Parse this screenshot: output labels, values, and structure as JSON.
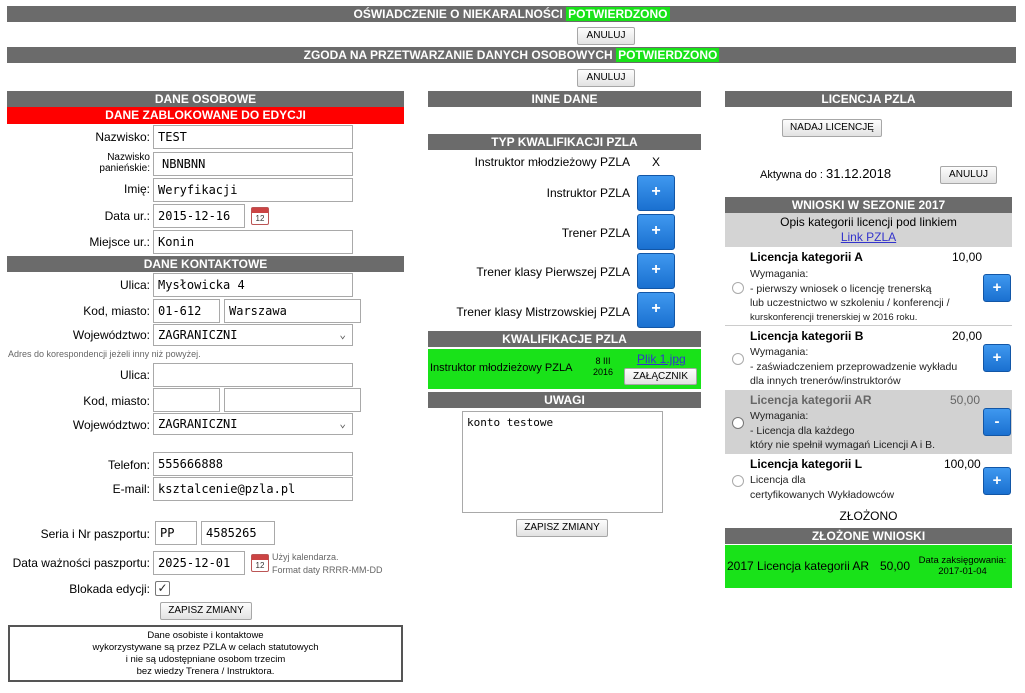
{
  "banners": {
    "statement": {
      "text": "OŚWIADCZENIE O NIEKARALNOŚCI",
      "status": "POTWIERDZONO",
      "cancel": "ANULUJ"
    },
    "consent": {
      "text": "ZGODA NA PRZETWARZANIE DANYCH OSOBOWYCH",
      "status": "POTWIERDZONO",
      "cancel": "ANULUJ"
    }
  },
  "personal": {
    "header": "DANE OSOBOWE",
    "locked": "DANE ZABLOKOWANE DO EDYCJI",
    "surname_label": "Nazwisko:",
    "surname": "TEST",
    "maiden_label_1": "Nazwisko",
    "maiden_label_2": "panieńskie:",
    "maiden": "NBNBNN",
    "name_label": "Imię:",
    "name": "Weryfikacji",
    "birth_label": "Data ur.:",
    "birth": "2015-12-16",
    "birthplace_label": "Miejsce ur.:",
    "birthplace": "Konin"
  },
  "contact": {
    "header": "DANE KONTAKTOWE",
    "street_label": "Ulica:",
    "street": "Mysłowicka 4",
    "postal_label": "Kod, miasto:",
    "postal": "01-612",
    "city": "Warszawa",
    "province_label": "Województwo:",
    "province": "ZAGRANICZNI",
    "corr_note": "Adres do korespondencji jeżeli inny niż powyżej.",
    "street2_label": "Ulica:",
    "street2": "",
    "postal2_label": "Kod, miasto:",
    "postal2": "",
    "city2": "",
    "province2_label": "Województwo:",
    "province2": "ZAGRANICZNI",
    "phone_label": "Telefon:",
    "phone": "555666888",
    "email_label": "E-mail:",
    "email": "ksztalcenie@pzla.pl",
    "passport_label": "Seria i Nr paszportu:",
    "passport_series": "PP",
    "passport_no": "4585265",
    "passport_valid_label": "Data ważności paszportu:",
    "passport_valid": "2025-12-01",
    "calendar_hint_1": "Użyj kalendarza.",
    "calendar_hint_2": "Format daty RRRR-MM-DD",
    "lock_label": "Blokada edycji:",
    "save": "ZAPISZ ZMIANY",
    "privacy_1": "Dane osobiste i kontaktowe",
    "privacy_2": "wykorzystywane są przez PZLA w celach statutowych",
    "privacy_3": "i nie są udostępniane osobom trzecim",
    "privacy_4": "bez wiedzy Trenera / Instruktora."
  },
  "other": {
    "header": "INNE DANE",
    "qual_type_header": "TYP KWALIFIKACJI PZLA",
    "qual_types": [
      {
        "label": "Instruktor młodzieżowy PZLA",
        "mark": "X"
      },
      {
        "label": "Instruktor PZLA",
        "mark": "+"
      },
      {
        "label": "Trener PZLA",
        "mark": "+"
      },
      {
        "label": "Trener klasy Pierwszej PZLA",
        "mark": "+"
      },
      {
        "label": "Trener klasy Mistrzowskiej PZLA",
        "mark": "+"
      }
    ],
    "quals_header": "KWALIFIKACJE PZLA",
    "qual": {
      "name": "Instruktor młodzieżowy PZLA",
      "date_1": "8 III",
      "date_2": "2016",
      "file": "Plik 1.jpg",
      "attach": "ZAŁĄCZNIK"
    },
    "notes_header": "UWAGI",
    "notes": "konto testowe",
    "save": "ZAPISZ ZMIANY"
  },
  "license": {
    "header": "LICENCJA PZLA",
    "grant": "NADAJ LICENCJĘ",
    "active_label": "Aktywna do :",
    "active_date": "31.12.2018",
    "cancel": "ANULUJ",
    "season_header": "WNIOSKI W SEZONIE 2017",
    "desc": "Opis kategorii licencji pod linkiem",
    "link": "Link PZLA",
    "categories": [
      {
        "name": "Licencja kategorii A",
        "price": "10,00",
        "req": "Wymagania:",
        "l1": "- pierwszy wniosek o licencję trenerską",
        "l2": "lub uczestnictwo w szkoleniu / konferencji /",
        "l3": "kurskonferencji trenerskiej w 2016 roku.",
        "action": "+"
      },
      {
        "name": "Licencja kategorii B",
        "price": "20,00",
        "req": "Wymagania:",
        "l1": "- zaświadczeniem przeprowadzenie wykładu",
        "l2": "dla innych trenerów/instruktorów",
        "action": "+"
      },
      {
        "name": "Licencja kategorii AR",
        "price": "50,00",
        "req": "Wymagania:",
        "l1": "- Licencja dla każdego",
        "l2": "który nie spełnił wymagań Licencji A i B.",
        "action": "-"
      },
      {
        "name": "Licencja kategorii L",
        "price": "100,00",
        "l1": "Licencja dla",
        "l2": "certyfikowanych Wykładowców",
        "action": "+"
      }
    ],
    "submitted": "ZŁOŻONO",
    "filed_header": "ZŁOŻONE WNIOSKI",
    "filed": {
      "name": "2017 Licencja kategorii AR",
      "price": "50,00",
      "date_label": "Data zaksięgowania:",
      "date": "2017-01-04"
    }
  },
  "colors": {
    "bar": "#6b6b6b",
    "ok": "#19e219",
    "locked": "#ff0000",
    "btn_blue": "#1a70d0"
  }
}
